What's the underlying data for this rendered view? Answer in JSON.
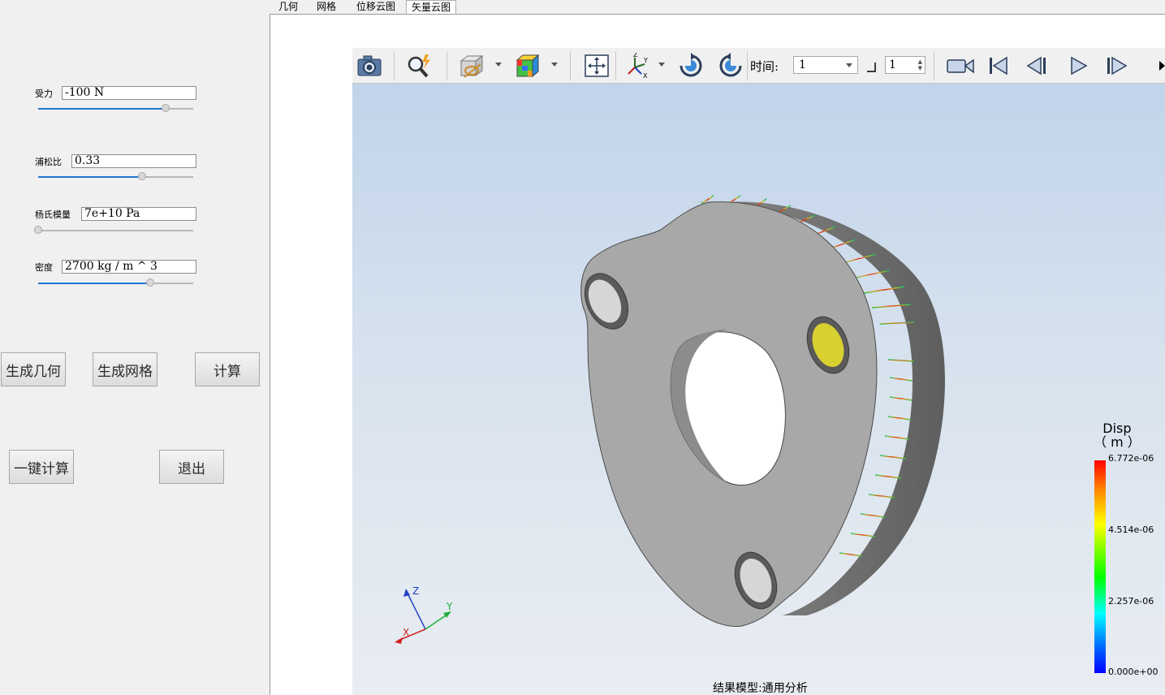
{
  "tabs": [
    {
      "label": "几何",
      "active": false
    },
    {
      "label": "网格",
      "active": false
    },
    {
      "label": "位移云图",
      "active": false
    },
    {
      "label": "矢量云图",
      "active": true
    }
  ],
  "params": {
    "force": {
      "label": "受力",
      "value": "-100 N",
      "slider_fraction": 0.82
    },
    "poisson": {
      "label": "浦松比",
      "value": "0.33",
      "slider_fraction": 0.67
    },
    "youngs": {
      "label": "杨氏模量",
      "value": "7e+10 Pa",
      "slider_fraction": 0.0
    },
    "density": {
      "label": "密度",
      "value": "2700 kg / m ^ 3",
      "slider_fraction": 0.72
    }
  },
  "buttons": {
    "gen_geometry": "生成几何",
    "gen_mesh": "生成网格",
    "compute": "计算",
    "one_click": "一键计算",
    "exit": "退出"
  },
  "toolbar": {
    "icons": [
      "camera-icon",
      "zoom-search-icon",
      "clip-plane-icon",
      "color-cube-icon",
      "fit-view-icon",
      "axes-orientation-icon",
      "rotate-cw-icon",
      "rotate-ccw-icon",
      "record-video-icon",
      "first-frame-icon",
      "prev-frame-icon",
      "play-icon",
      "next-frame-icon",
      "last-frame-icon"
    ],
    "time_label": "时间:",
    "time_value": "1",
    "step_value": "1"
  },
  "axes": {
    "x": "X",
    "y": "Y",
    "z": "Z"
  },
  "legend": {
    "title_line1": "Disp",
    "title_line2": "（ m ）",
    "max": "6.772e-06",
    "v3": "4.514e-06",
    "v2": "2.257e-06",
    "min": "0.000e+00",
    "colors": [
      "#ff0000",
      "#ffff00",
      "#00ff00",
      "#00ffff",
      "#0000ff"
    ]
  },
  "status": "结果模型:通用分析"
}
